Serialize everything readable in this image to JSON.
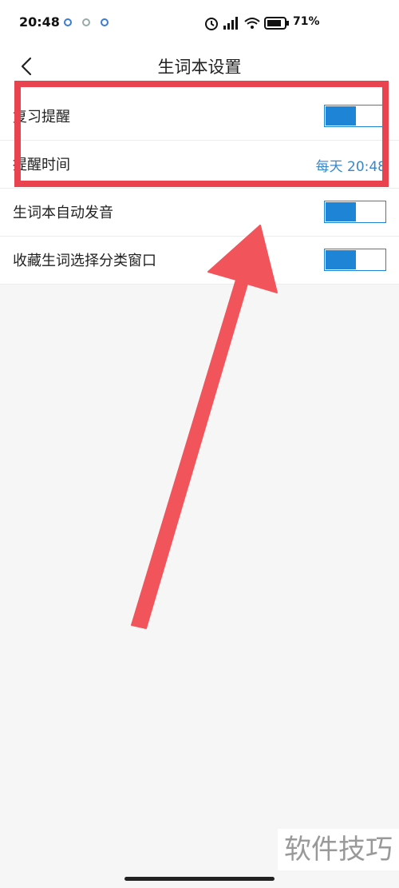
{
  "status_bar": {
    "time": "20:48",
    "battery_percent": "71%",
    "icons": [
      "alarm-icon",
      "hd-signal-icon",
      "wifi-icon",
      "battery-icon"
    ]
  },
  "nav": {
    "title": "生词本设置",
    "back_icon": "chevron-left-icon"
  },
  "settings": [
    {
      "label": "复习提醒",
      "type": "toggle",
      "on": true
    },
    {
      "label": "提醒时间",
      "type": "value",
      "value": "每天 20:48"
    },
    {
      "label": "生词本自动发音",
      "type": "toggle",
      "on": true
    },
    {
      "label": "收藏生词选择分类窗口",
      "type": "toggle",
      "on": true
    }
  ],
  "annotation": {
    "highlight_color": "#e8434f",
    "arrow_color": "#f2545b"
  },
  "watermark": "软件技巧",
  "colors": {
    "accent": "#1e84d6",
    "value_text": "#3a87c8"
  }
}
